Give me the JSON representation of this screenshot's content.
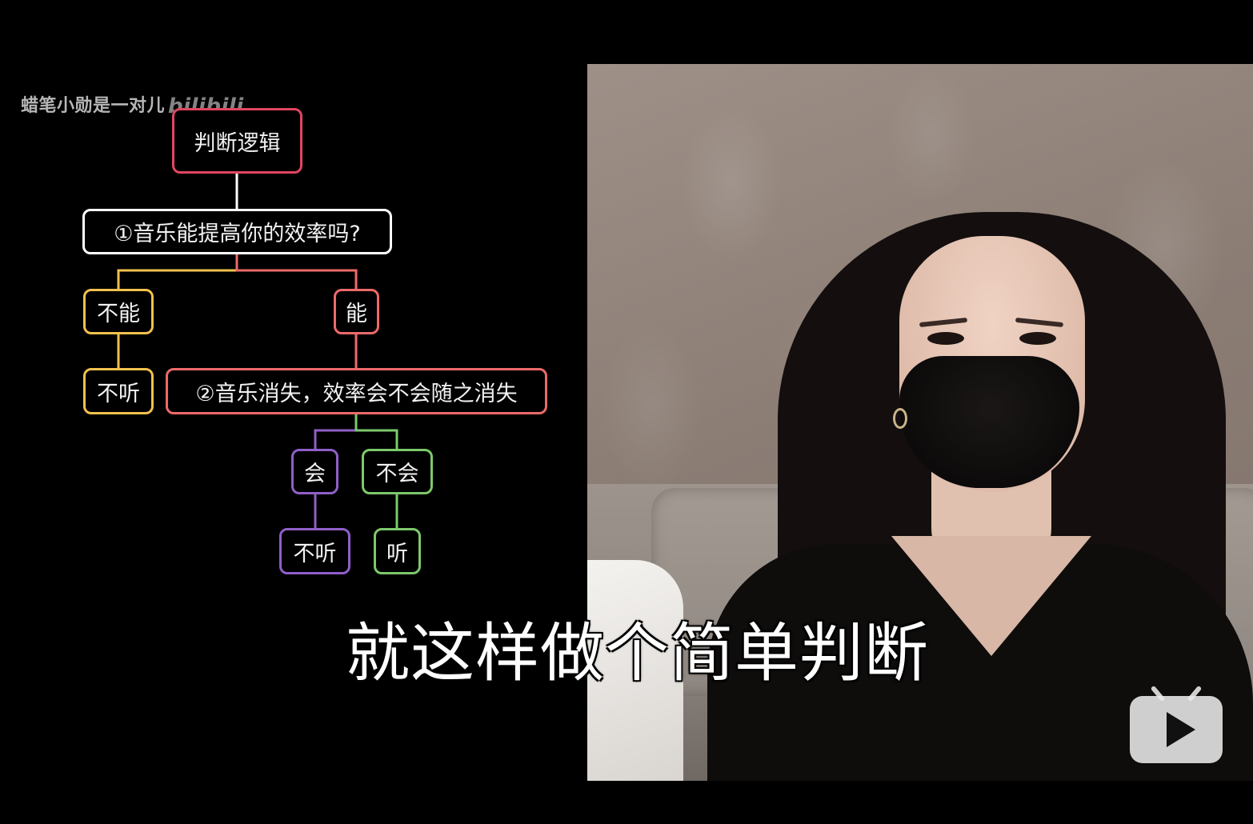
{
  "watermark": {
    "text": "蜡笔小勋是一对儿",
    "logo": "bilibili"
  },
  "flowchart": {
    "root": "判断逻辑",
    "q1": "①音乐能提高你的效率吗?",
    "q1_no": "不能",
    "q1_no_result": "不听",
    "q1_yes": "能",
    "q2": "②音乐消失，效率会不会随之消失",
    "q2_yes": "会",
    "q2_yes_result": "不听",
    "q2_no": "不会",
    "q2_no_result": "听"
  },
  "colors": {
    "root": "#e0465f",
    "q1": "#ffffff",
    "no_branch": "#f2c14e",
    "yes_branch": "#ec6a6a",
    "q2_yes_branch": "#8f5fc8",
    "q2_no_branch": "#7cc96b"
  },
  "subtitle": "就这样做个简单判断",
  "player": {
    "icon": "tv-play-icon"
  }
}
